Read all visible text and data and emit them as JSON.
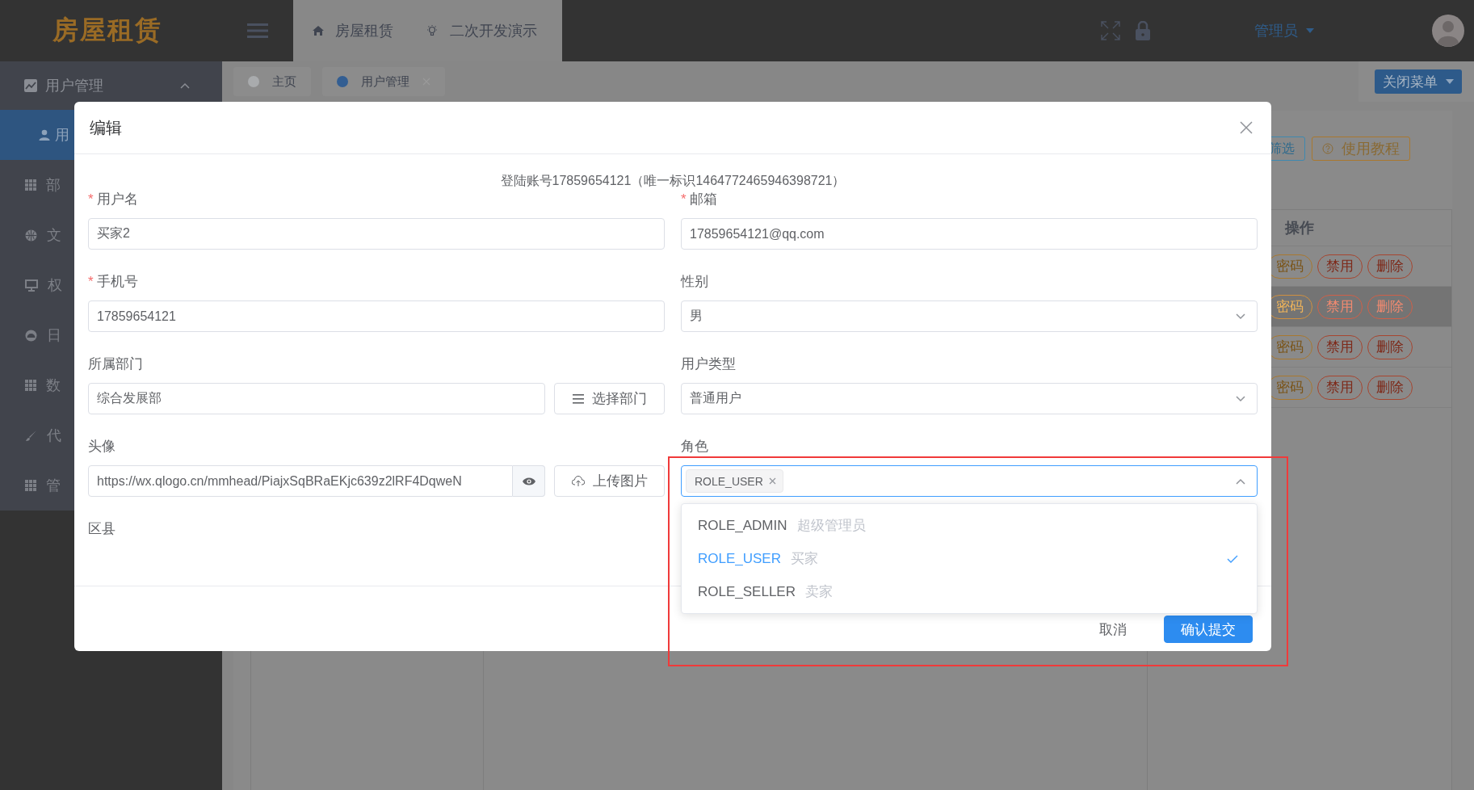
{
  "header": {
    "logo": "房屋租赁",
    "nav_tabs": [
      {
        "label": "房屋租赁"
      },
      {
        "label": "二次开发演示"
      }
    ],
    "user": "管理员"
  },
  "sidebar": {
    "group": {
      "label": "用户管理",
      "expanded": true,
      "children": [
        {
          "label": "用",
          "selected": true
        }
      ]
    },
    "items": [
      {
        "label": "部"
      },
      {
        "label": "文"
      },
      {
        "label": "权"
      },
      {
        "label": "日"
      },
      {
        "label": "数"
      },
      {
        "label": "代"
      },
      {
        "label": "管"
      }
    ]
  },
  "page_tabs": [
    {
      "label": "主页",
      "selected": false
    },
    {
      "label": "用户管理",
      "selected": true
    }
  ],
  "close_menu": "关闭菜单",
  "toolbar": [
    {
      "kind": "info",
      "label": "筛选"
    },
    {
      "kind": "warning",
      "label": "使用教程"
    }
  ],
  "table": {
    "column_3": "操作",
    "rows": [
      {
        "selected": false,
        "actions": [
          {
            "kind": "warning",
            "label": "密码"
          },
          {
            "kind": "danger",
            "label": "禁用"
          },
          {
            "kind": "danger",
            "label": "删除"
          }
        ]
      },
      {
        "selected": true,
        "actions": [
          {
            "kind": "warning",
            "label": "密码"
          },
          {
            "kind": "danger",
            "label": "禁用"
          },
          {
            "kind": "danger",
            "label": "删除"
          }
        ]
      },
      {
        "selected": false,
        "actions": [
          {
            "kind": "warning",
            "label": "密码"
          },
          {
            "kind": "danger",
            "label": "禁用"
          },
          {
            "kind": "danger",
            "label": "删除"
          }
        ]
      },
      {
        "selected": false,
        "actions": [
          {
            "kind": "warning",
            "label": "密码"
          },
          {
            "kind": "danger",
            "label": "禁用"
          },
          {
            "kind": "danger",
            "label": "删除"
          }
        ]
      }
    ]
  },
  "modal": {
    "title": "编辑",
    "info": "登陆账号17859654121（唯一标识1464772465946398721）",
    "fields": [
      {
        "kind": "input",
        "mark": "*",
        "label": "用户名",
        "value": "买家2"
      },
      {
        "kind": "input",
        "mark": "*",
        "label": "邮箱",
        "value": "17859654121@qq.com"
      },
      {
        "kind": "input",
        "mark": "*",
        "label": "手机号",
        "value": "17859654121"
      },
      {
        "kind": "select",
        "label": "性别",
        "value": "男",
        "expanded": false
      },
      {
        "kind": "picker",
        "label": "所属部门",
        "value": "综合发展部",
        "button": "选择部门"
      },
      {
        "kind": "select",
        "label": "用户类型",
        "value": "普通用户",
        "expanded": false
      },
      {
        "kind": "upload",
        "label": "头像",
        "value": "https://wx.qlogo.cn/mmhead/PiajxSqBRaEKjc639z2lRF4DqweN",
        "button": "上传图片"
      },
      {
        "kind": "tags",
        "label": "角色",
        "tags": [
          "ROLE_USER"
        ],
        "expanded": true,
        "options": [
          {
            "code": "ROLE_ADMIN",
            "desc": "超级管理员",
            "selected": false
          },
          {
            "code": "ROLE_USER",
            "desc": "买家",
            "selected": true
          },
          {
            "code": "ROLE_SELLER",
            "desc": "卖家",
            "selected": false
          }
        ]
      },
      {
        "kind": "label",
        "label": "区县"
      }
    ],
    "buttons": [
      {
        "kind": "text",
        "label": "取消"
      },
      {
        "kind": "primary",
        "label": "确认提交"
      }
    ]
  }
}
